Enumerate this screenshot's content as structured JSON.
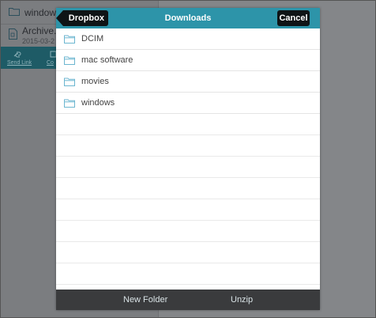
{
  "background": {
    "rows": [
      {
        "name": "windows"
      },
      {
        "name": "Archive.z",
        "date": "2015-03-2"
      }
    ],
    "actions": [
      "Send Link",
      "Co"
    ]
  },
  "dialog": {
    "title": "Downloads",
    "back_label": "Dropbox",
    "cancel_label": "Cancel",
    "folders": [
      {
        "label": "DCIM"
      },
      {
        "label": "mac software"
      },
      {
        "label": "movies"
      },
      {
        "label": "windows"
      }
    ],
    "footer": {
      "new_folder_label": "New Folder",
      "unzip_label": "Unzip"
    }
  },
  "colors": {
    "header": "#2d94a9",
    "footer": "#3a3b3d",
    "folder_icon": "#6cb6d0"
  }
}
